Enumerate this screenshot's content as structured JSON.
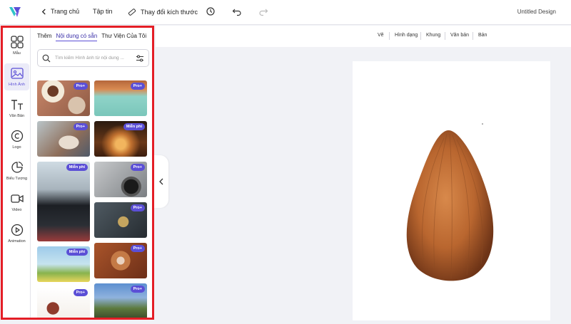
{
  "topbar": {
    "home": "Trang chủ",
    "file": "Tập tin",
    "resize": "Thay đổi kích thước",
    "document_title": "Untitled Design"
  },
  "rail": {
    "items": [
      {
        "label": "Mẫu"
      },
      {
        "label": "Hình Ảnh"
      },
      {
        "label": "Văn Bản"
      },
      {
        "label": "Logo"
      },
      {
        "label": "Biểu Tượng"
      },
      {
        "label": "Video"
      },
      {
        "label": "Animation"
      }
    ]
  },
  "panel": {
    "tabs": [
      {
        "label": "Thêm"
      },
      {
        "label": "Nội dung có sẵn"
      },
      {
        "label": "Thư Viện Của Tôi"
      }
    ],
    "search_placeholder": "Tìm kiếm Hình ảnh từ nội dung ...",
    "tiles": [
      {
        "badge": "Pro+"
      },
      {
        "badge": "Pro+"
      },
      {
        "badge": "Pro+"
      },
      {
        "badge": "Miễn phí"
      },
      {
        "badge": "Miễn phí"
      },
      {
        "badge": "Pro+"
      },
      {
        "badge": "Pro+"
      },
      {
        "badge": "Miễn phí"
      },
      {
        "badge": "Pro+"
      },
      {
        "badge": "Pro+"
      },
      {
        "badge": "Pro+"
      }
    ]
  },
  "canvas_toolbar": {
    "items": [
      {
        "label": "Vẽ"
      },
      {
        "label": "Hình dạng"
      },
      {
        "label": "Khung"
      },
      {
        "label": "Văn bản"
      },
      {
        "label": "Bản"
      }
    ]
  },
  "colors": {
    "accent": "#5b4fd6",
    "highlight_frame": "#e41e26"
  }
}
